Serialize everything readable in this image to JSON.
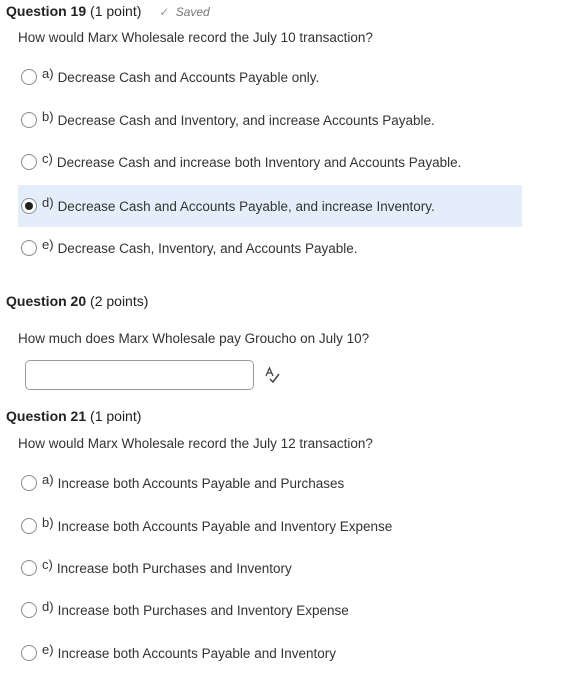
{
  "questions": [
    {
      "title": "Question 19",
      "points": "(1 point)",
      "saved": "Saved",
      "text": "How would Marx Wholesale record the July 10 transaction?",
      "options": [
        {
          "letter": "a)",
          "text": "Decrease Cash and Accounts Payable only.",
          "selected": false
        },
        {
          "letter": "b)",
          "text": "Decrease Cash and Inventory, and increase Accounts Payable.",
          "selected": false
        },
        {
          "letter": "c)",
          "text": "Decrease Cash and increase both Inventory and Accounts Payable.",
          "selected": false
        },
        {
          "letter": "d)",
          "text": "Decrease Cash and Accounts Payable, and increase Inventory.",
          "selected": true
        },
        {
          "letter": "e)",
          "text": "Decrease Cash, Inventory, and Accounts Payable.",
          "selected": false
        }
      ]
    },
    {
      "title": "Question 20",
      "points": "(2 points)",
      "text": "How much does Marx Wholesale pay Groucho on July 10?",
      "answer_value": ""
    },
    {
      "title": "Question 21",
      "points": "(1 point)",
      "text": "How would Marx Wholesale record the July 12 transaction?",
      "options": [
        {
          "letter": "a)",
          "text": "Increase both Accounts Payable and Purchases",
          "selected": false
        },
        {
          "letter": "b)",
          "text": "Increase both Accounts Payable and Inventory Expense",
          "selected": false
        },
        {
          "letter": "c)",
          "text": "Increase both Purchases and Inventory",
          "selected": false
        },
        {
          "letter": "d)",
          "text": "Increase both Purchases and Inventory Expense",
          "selected": false
        },
        {
          "letter": "e)",
          "text": "Increase both Accounts Payable and Inventory",
          "selected": false
        }
      ]
    }
  ],
  "icons": {
    "saved": "check-icon",
    "spellcheck": "spellcheck-icon"
  },
  "colors": {
    "selected_bg": "#e4eefb",
    "text": "#333333"
  }
}
